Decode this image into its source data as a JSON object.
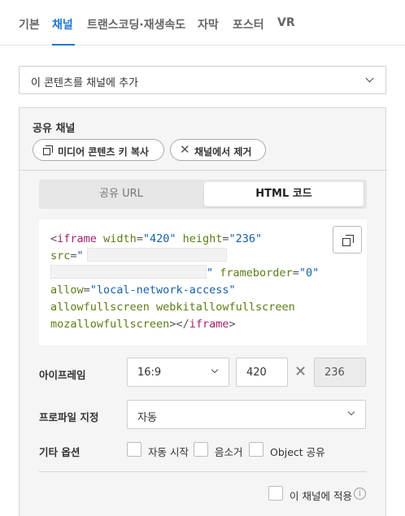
{
  "tabs": [
    {
      "label": "기본",
      "active": false
    },
    {
      "label": "채널",
      "active": true
    },
    {
      "label": "트랜스코딩·재생속도",
      "active": false
    },
    {
      "label": "자막",
      "active": false
    },
    {
      "label": "포스터",
      "active": false
    },
    {
      "label": "VR",
      "active": false
    }
  ],
  "add_channel": {
    "label": "이 콘텐츠를 채널에 추가"
  },
  "shared": {
    "title": "공유 채널",
    "copy_key_label": "미디어 콘텐츠 키 복사",
    "remove_label": "채널에서 제거"
  },
  "subtabs": {
    "url": "공유 URL",
    "html": "HTML 코드",
    "active": "html"
  },
  "code": {
    "open_bracket": "<",
    "tag": "iframe",
    "width_attr": "width",
    "width_val": "\"420\"",
    "height_attr": "height",
    "height_val": "\"236\"",
    "src_attr": "src",
    "src_open": "\"",
    "src_close": "\"",
    "frameborder_attr": "frameborder",
    "frameborder_val": "\"0\"",
    "allow_attr": "allow",
    "allow_val": "\"local-network-access\"",
    "flags_line1": "allowfullscreen webkitallowfullscreen",
    "flags_line2": "mozallowfullscreen",
    "close_open": "></",
    "close_tag": "iframe",
    "close_end": ">",
    "eq": "="
  },
  "iframe_row": {
    "label": "아이프레임",
    "ratio": "16:9",
    "width": "420",
    "times": "✕",
    "height": "236"
  },
  "profile_row": {
    "label": "프로파일 지정",
    "value": "자동"
  },
  "options_row": {
    "label": "기타 옵션",
    "options": [
      {
        "label": "자동 시작",
        "checked": false
      },
      {
        "label": "음소거",
        "checked": false
      },
      {
        "label": "Object 공유",
        "checked": false
      }
    ]
  },
  "apply": {
    "label": "이 채널에 적용",
    "checked": false,
    "info_icon": "i"
  },
  "colors": {
    "accent": "#1976d2",
    "tag": "#a61e6a",
    "attr": "#5a7d12",
    "string": "#1560a8"
  }
}
